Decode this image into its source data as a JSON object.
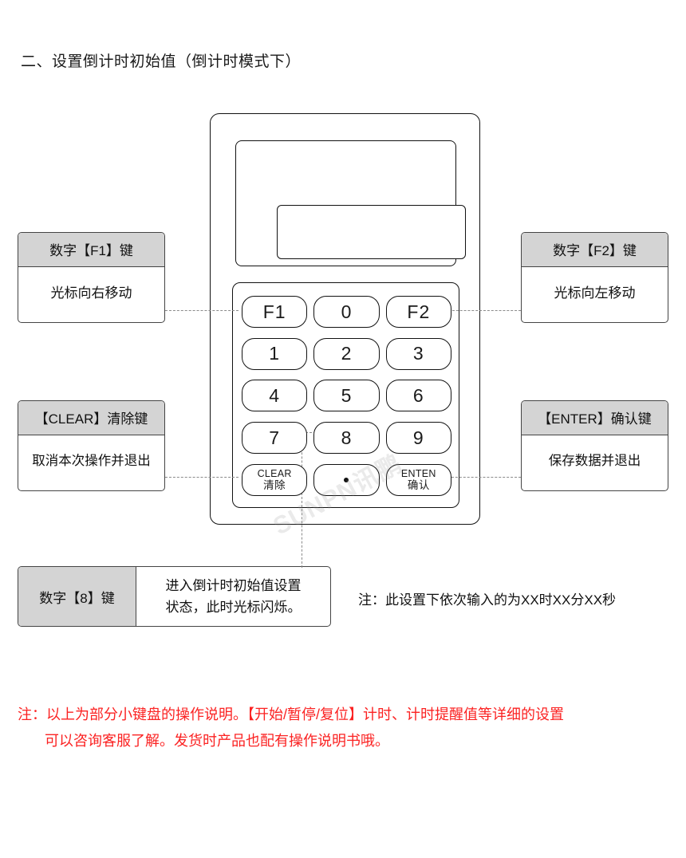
{
  "title": "二、设置倒计时初始值（倒计时模式下）",
  "device": {
    "name": "numeric-keypad-device",
    "screen_value": "",
    "watermark": "SUNPN讯鹏",
    "keys": [
      {
        "id": "f1",
        "label": "F1"
      },
      {
        "id": "0",
        "label": "0"
      },
      {
        "id": "f2",
        "label": "F2"
      },
      {
        "id": "1",
        "label": "1"
      },
      {
        "id": "2",
        "label": "2"
      },
      {
        "id": "3",
        "label": "3"
      },
      {
        "id": "4",
        "label": "4"
      },
      {
        "id": "5",
        "label": "5"
      },
      {
        "id": "6",
        "label": "6"
      },
      {
        "id": "7",
        "label": "7"
      },
      {
        "id": "8",
        "label": "8"
      },
      {
        "id": "9",
        "label": "9"
      },
      {
        "id": "clear",
        "label_en": "CLEAR",
        "label_cn": "清除"
      },
      {
        "id": "dot",
        "label": "·"
      },
      {
        "id": "enter",
        "label_en": "ENTEN",
        "label_cn": "确认"
      }
    ]
  },
  "callouts": {
    "f1": {
      "head": "数字【F1】键",
      "body": "光标向右移动"
    },
    "f2": {
      "head": "数字【F2】键",
      "body": "光标向左移动"
    },
    "clear": {
      "head": "【CLEAR】清除键",
      "body": "取消本次操作并退出"
    },
    "enter": {
      "head": "【ENTER】确认键",
      "body": "保存数据并退出"
    },
    "eight": {
      "head": "数字【8】键",
      "body_line1": "进入倒计时初始值设置",
      "body_line2": "状态，此时光标闪烁。"
    }
  },
  "notes": {
    "inline": "注：此设置下依次输入的为XX时XX分XX秒",
    "red_line1": "注：以上为部分小键盘的操作说明。【开始/暂停/复位】计时、计时提醒值等详细的设置",
    "red_line2": "可以咨询客服了解。发货时产品也配有操作说明书哦。",
    "red_color": "#fb2222"
  },
  "colors": {
    "header_bg": "#d4d4d4",
    "border": "#444444",
    "device_line": "#111111",
    "connector": "#8a8a8a"
  }
}
